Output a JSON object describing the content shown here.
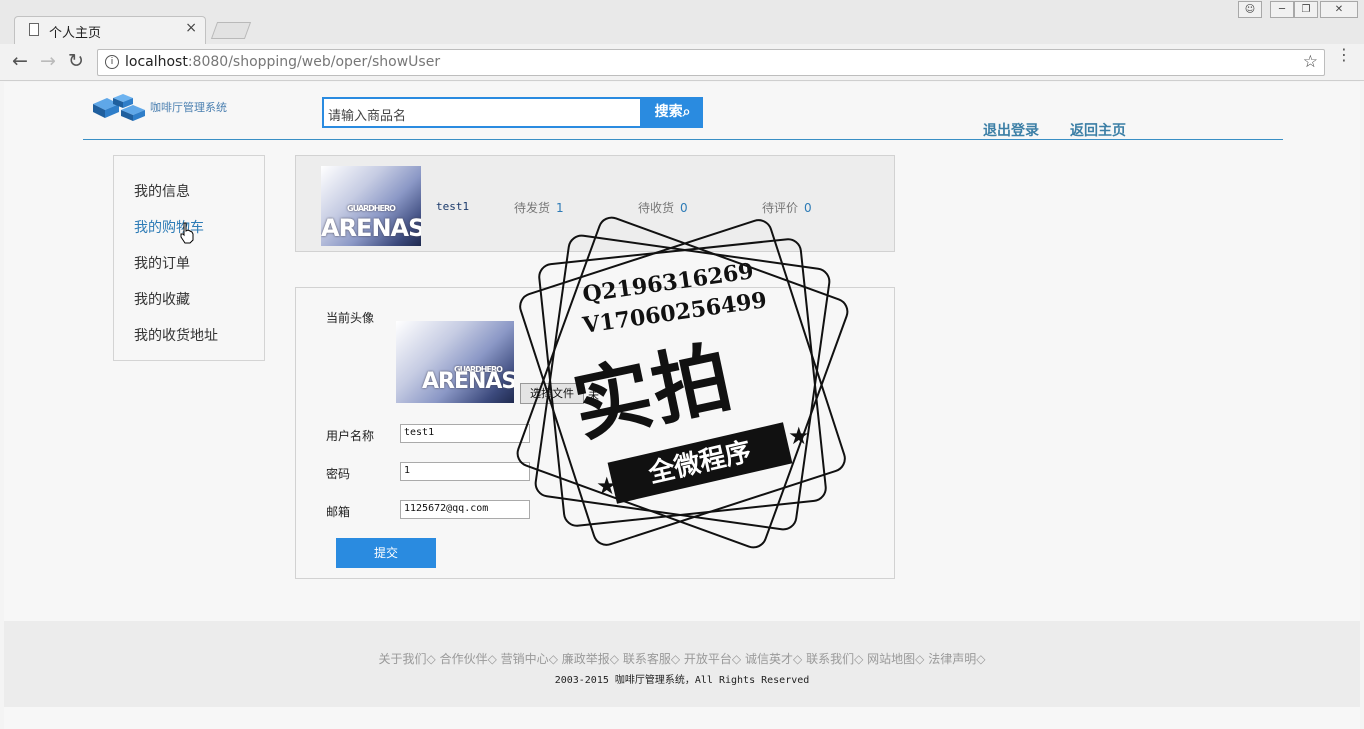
{
  "browser": {
    "tab_title": "个人主页",
    "tab_close": "×",
    "url_host": "localhost",
    "url_rest": ":8080/shopping/web/oper/showUser",
    "back": "←",
    "forward": "→",
    "reload": "↻",
    "info": "i",
    "star": "☆",
    "menu": "⋮",
    "win_user": "☺",
    "win_min": "─",
    "win_max": "❐",
    "win_close": "✕"
  },
  "header": {
    "logo_text": "咖啡厅管理系统",
    "search_placeholder": "请输入商品名",
    "search_button": "搜索",
    "search_icon": "⌕",
    "logout": "退出登录",
    "home": "返回主页"
  },
  "sidebar": {
    "items": [
      {
        "label": "我的信息"
      },
      {
        "label": "我的购物车"
      },
      {
        "label": "我的订单"
      },
      {
        "label": "我的收藏"
      },
      {
        "label": "我的收货地址"
      }
    ]
  },
  "summary": {
    "username": "test1",
    "avatar_text": "ARENAS",
    "avatar_small": "GUARDHERO",
    "stats": [
      {
        "label": "待发货",
        "value": "1"
      },
      {
        "label": "待收货",
        "value": "0"
      },
      {
        "label": "待评价",
        "value": "0"
      }
    ]
  },
  "form": {
    "avatar_label": "当前头像",
    "file_button": "选择文件",
    "file_status": "未",
    "username_label": "用户名称",
    "username_value": "test1",
    "password_label": "密码",
    "password_value": "1",
    "email_label": "邮箱",
    "email_value": "1125672@qq.com",
    "submit": "提交"
  },
  "watermark": {
    "line1": "Q2196316269",
    "line2": "V17060256499",
    "big": "实拍",
    "ribbon": "全微程序",
    "star": "★"
  },
  "footer": {
    "links": [
      "关于我们",
      "合作伙伴",
      "营销中心",
      "廉政举报",
      "联系客服",
      "开放平台",
      "诚信英才",
      "联系我们",
      "网站地图",
      "法律声明"
    ],
    "separator": "◇",
    "copyright": "2003-2015 咖啡厅管理系统，All Rights Reserved"
  }
}
